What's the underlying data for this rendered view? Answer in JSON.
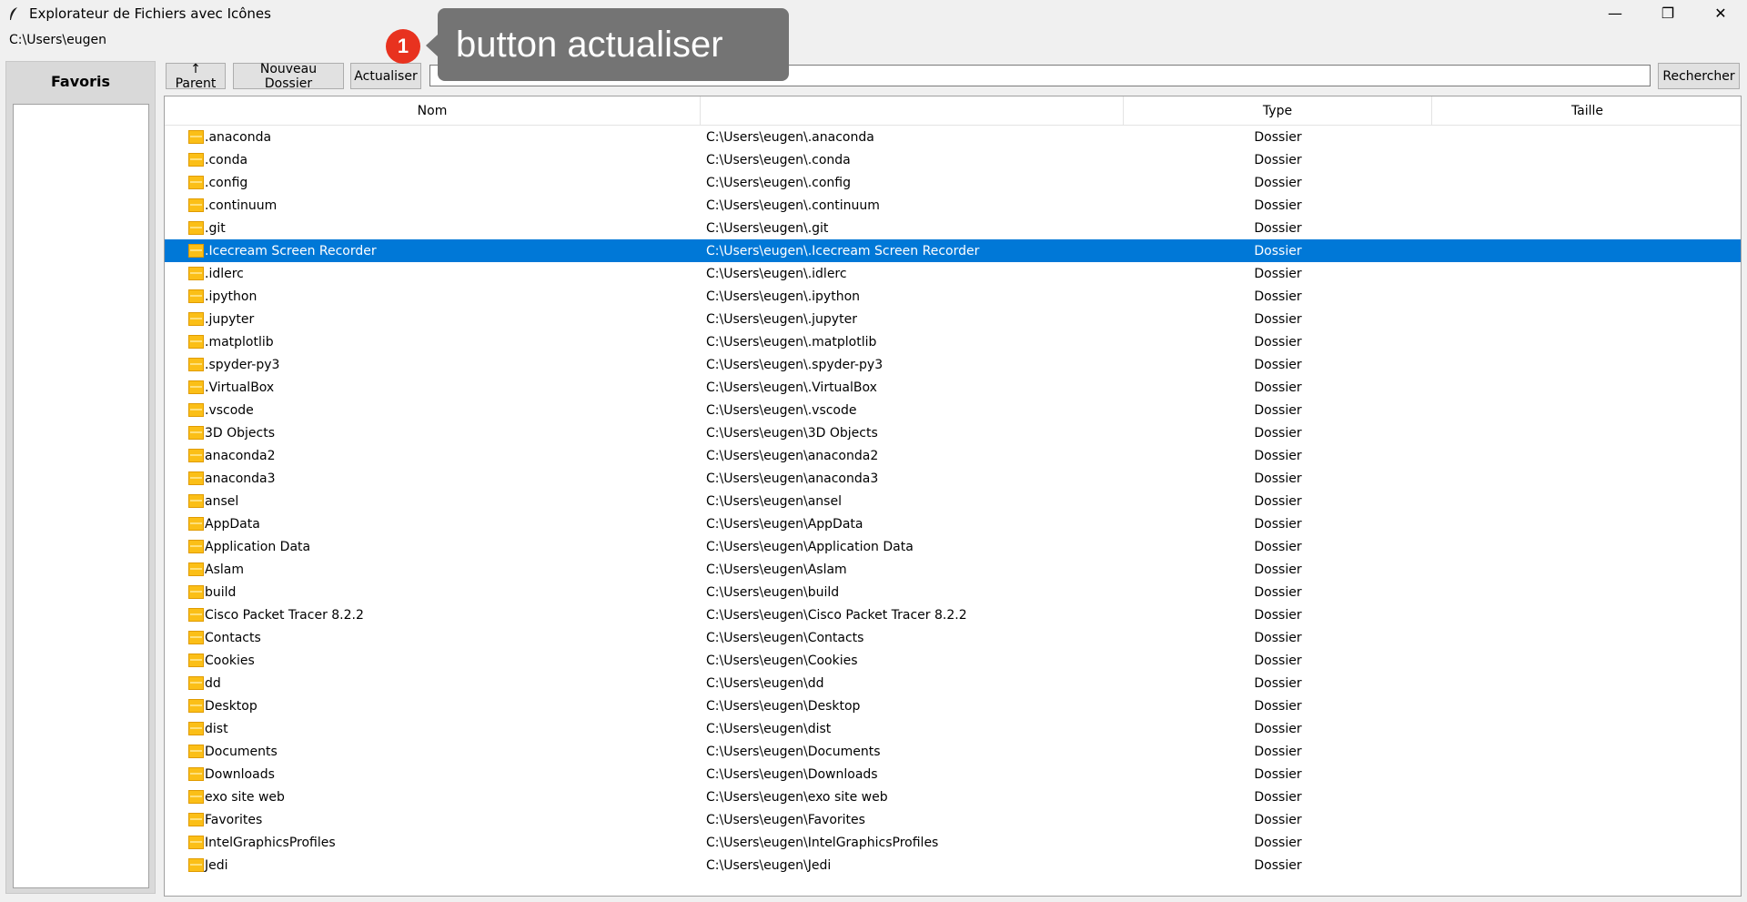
{
  "window": {
    "title": "Explorateur de Fichiers avec Icônes",
    "minimize_glyph": "—",
    "restore_glyph": "❐",
    "close_glyph": "✕"
  },
  "path": "C:\\Users\\eugen",
  "sidebar": {
    "title": "Favoris"
  },
  "toolbar": {
    "parent_label": "↑ Parent",
    "new_folder_label": "Nouveau Dossier",
    "refresh_label": "Actualiser",
    "search_value": "",
    "search_label": "Rechercher"
  },
  "columns": {
    "name": "Nom",
    "path": "",
    "type": "Type",
    "size": "Taille"
  },
  "files": [
    {
      "name": ".anaconda",
      "path": "C:\\Users\\eugen\\.anaconda",
      "type": "Dossier",
      "size": ""
    },
    {
      "name": ".conda",
      "path": "C:\\Users\\eugen\\.conda",
      "type": "Dossier",
      "size": ""
    },
    {
      "name": ".config",
      "path": "C:\\Users\\eugen\\.config",
      "type": "Dossier",
      "size": ""
    },
    {
      "name": ".continuum",
      "path": "C:\\Users\\eugen\\.continuum",
      "type": "Dossier",
      "size": ""
    },
    {
      "name": ".git",
      "path": "C:\\Users\\eugen\\.git",
      "type": "Dossier",
      "size": ""
    },
    {
      "name": ".Icecream Screen Recorder",
      "path": "C:\\Users\\eugen\\.Icecream Screen Recorder",
      "type": "Dossier",
      "size": "",
      "selected": true
    },
    {
      "name": ".idlerc",
      "path": "C:\\Users\\eugen\\.idlerc",
      "type": "Dossier",
      "size": ""
    },
    {
      "name": ".ipython",
      "path": "C:\\Users\\eugen\\.ipython",
      "type": "Dossier",
      "size": ""
    },
    {
      "name": ".jupyter",
      "path": "C:\\Users\\eugen\\.jupyter",
      "type": "Dossier",
      "size": ""
    },
    {
      "name": ".matplotlib",
      "path": "C:\\Users\\eugen\\.matplotlib",
      "type": "Dossier",
      "size": ""
    },
    {
      "name": ".spyder-py3",
      "path": "C:\\Users\\eugen\\.spyder-py3",
      "type": "Dossier",
      "size": ""
    },
    {
      "name": ".VirtualBox",
      "path": "C:\\Users\\eugen\\.VirtualBox",
      "type": "Dossier",
      "size": ""
    },
    {
      "name": ".vscode",
      "path": "C:\\Users\\eugen\\.vscode",
      "type": "Dossier",
      "size": ""
    },
    {
      "name": "3D Objects",
      "path": "C:\\Users\\eugen\\3D Objects",
      "type": "Dossier",
      "size": ""
    },
    {
      "name": "anaconda2",
      "path": "C:\\Users\\eugen\\anaconda2",
      "type": "Dossier",
      "size": ""
    },
    {
      "name": "anaconda3",
      "path": "C:\\Users\\eugen\\anaconda3",
      "type": "Dossier",
      "size": ""
    },
    {
      "name": "ansel",
      "path": "C:\\Users\\eugen\\ansel",
      "type": "Dossier",
      "size": ""
    },
    {
      "name": "AppData",
      "path": "C:\\Users\\eugen\\AppData",
      "type": "Dossier",
      "size": ""
    },
    {
      "name": "Application Data",
      "path": "C:\\Users\\eugen\\Application Data",
      "type": "Dossier",
      "size": ""
    },
    {
      "name": "Aslam",
      "path": "C:\\Users\\eugen\\Aslam",
      "type": "Dossier",
      "size": ""
    },
    {
      "name": "build",
      "path": "C:\\Users\\eugen\\build",
      "type": "Dossier",
      "size": ""
    },
    {
      "name": "Cisco Packet Tracer 8.2.2",
      "path": "C:\\Users\\eugen\\Cisco Packet Tracer 8.2.2",
      "type": "Dossier",
      "size": ""
    },
    {
      "name": "Contacts",
      "path": "C:\\Users\\eugen\\Contacts",
      "type": "Dossier",
      "size": ""
    },
    {
      "name": "Cookies",
      "path": "C:\\Users\\eugen\\Cookies",
      "type": "Dossier",
      "size": ""
    },
    {
      "name": "dd",
      "path": "C:\\Users\\eugen\\dd",
      "type": "Dossier",
      "size": ""
    },
    {
      "name": "Desktop",
      "path": "C:\\Users\\eugen\\Desktop",
      "type": "Dossier",
      "size": ""
    },
    {
      "name": "dist",
      "path": "C:\\Users\\eugen\\dist",
      "type": "Dossier",
      "size": ""
    },
    {
      "name": "Documents",
      "path": "C:\\Users\\eugen\\Documents",
      "type": "Dossier",
      "size": ""
    },
    {
      "name": "Downloads",
      "path": "C:\\Users\\eugen\\Downloads",
      "type": "Dossier",
      "size": ""
    },
    {
      "name": "exo site web",
      "path": "C:\\Users\\eugen\\exo site web",
      "type": "Dossier",
      "size": ""
    },
    {
      "name": "Favorites",
      "path": "C:\\Users\\eugen\\Favorites",
      "type": "Dossier",
      "size": ""
    },
    {
      "name": "IntelGraphicsProfiles",
      "path": "C:\\Users\\eugen\\IntelGraphicsProfiles",
      "type": "Dossier",
      "size": ""
    },
    {
      "name": "Jedi",
      "path": "C:\\Users\\eugen\\Jedi",
      "type": "Dossier",
      "size": ""
    }
  ],
  "annotation": {
    "badge": "1",
    "text": "button actualiser"
  },
  "colors": {
    "selection": "#0078d7",
    "folder": "#fbbf17",
    "annotation_bg": "#747474",
    "badge": "#e8321f"
  }
}
